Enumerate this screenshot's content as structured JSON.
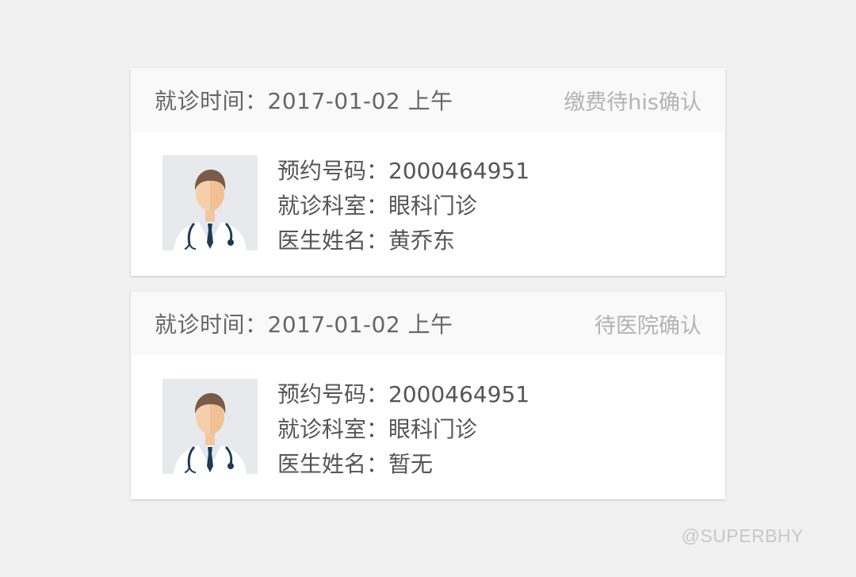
{
  "appointments": [
    {
      "visit_time_label": "就诊时间：",
      "visit_time_value": "2017-01-02 上午",
      "status": "缴费待his确认",
      "fields": [
        {
          "label": "预约号码：",
          "value": "2000464951"
        },
        {
          "label": "就诊科室：",
          "value": "眼科门诊"
        },
        {
          "label": "医生姓名：",
          "value": "黄乔东"
        }
      ]
    },
    {
      "visit_time_label": "就诊时间：",
      "visit_time_value": "2017-01-02 上午",
      "status": "待医院确认",
      "fields": [
        {
          "label": "预约号码：",
          "value": "2000464951"
        },
        {
          "label": "就诊科室：",
          "value": "眼科门诊"
        },
        {
          "label": "医生姓名：",
          "value": "暂无"
        }
      ]
    }
  ],
  "watermark": "@SUPERBHY",
  "icons": {
    "avatar": "doctor-avatar-icon"
  },
  "colors": {
    "page_background": "#f1f1f1",
    "card_header_background": "#f9f9f9",
    "status_text": "#b3b3b3",
    "body_text": "#555555"
  }
}
